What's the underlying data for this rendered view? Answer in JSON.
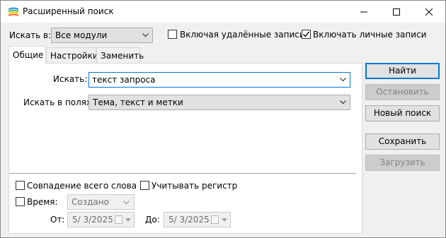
{
  "window": {
    "title": "Расширенный поиск",
    "controls": [
      "minimize-icon",
      "maximize-icon",
      "close-icon"
    ]
  },
  "top": {
    "search_in_label": "Искать в:",
    "search_in_value": "Все модули",
    "include_deleted_label": "Включая удалённые записи",
    "include_deleted_checked": false,
    "include_personal_label": "Включать личные записи",
    "include_personal_checked": true
  },
  "tabs": [
    {
      "label": "Общие",
      "active": true
    },
    {
      "label": "Настройки",
      "active": false
    },
    {
      "label": "Заменить",
      "active": false
    }
  ],
  "general": {
    "query_label": "Искать:",
    "query_value": "текст запроса",
    "fields_label": "Искать в полях:",
    "fields_value": "Тема, текст и метки",
    "whole_word_label": "Совпадение всего слова",
    "whole_word_checked": false,
    "match_case_label": "Учитывать регистр",
    "match_case_checked": false,
    "time_label": "Время:",
    "time_checked": false,
    "time_value": "Создано",
    "from_label": "От:",
    "from_value": "5/  3/2025",
    "to_label": "До:",
    "to_value": "5/  3/2025"
  },
  "buttons": {
    "find": "Найти",
    "stop": "Остановить",
    "new_search": "Новый поиск",
    "save": "Сохранить",
    "load": "Загрузить"
  },
  "colors": {
    "focus_border": "#0078d7",
    "disabled_text": "#838383"
  }
}
